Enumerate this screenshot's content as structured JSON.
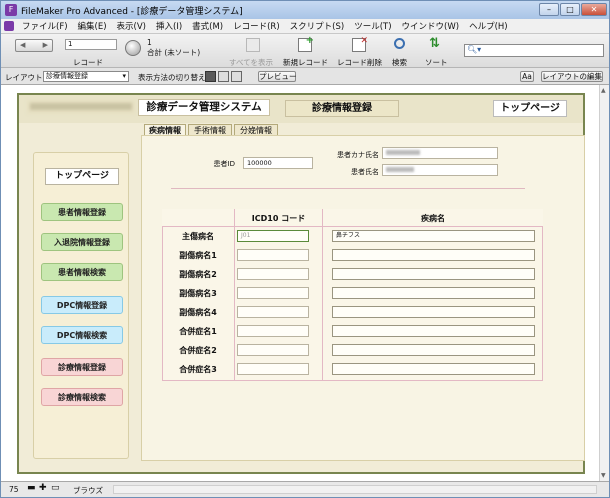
{
  "window": {
    "title": "FileMaker Pro Advanced - [診療データ管理システム]",
    "controls": [
      "–",
      "□",
      "✕"
    ]
  },
  "menu": [
    "ファイル(F)",
    "編集(E)",
    "表示(V)",
    "挿入(I)",
    "書式(M)",
    "レコード(R)",
    "スクリプト(S)",
    "ツール(T)",
    "ウインドウ(W)",
    "ヘルプ(H)"
  ],
  "toolbar": {
    "record_label": "レコード",
    "record_number": "1",
    "total_count": "1",
    "total_label": "合計 (未ソート)",
    "show_all": "すべてを表示",
    "new_record": "新規レコード",
    "delete_record": "レコード削除",
    "find": "検索",
    "sort": "ソート"
  },
  "layoutbar": {
    "layout_label": "レイアウト:",
    "layout_value": "診療情報登録",
    "view_label": "表示方法の切り替え:",
    "preview": "プレビュー",
    "aa": "Aa",
    "edit_layout": "レイアウトの編集"
  },
  "status": {
    "zoom": "75",
    "mode": "ブラウズ"
  },
  "header": {
    "system_title": "診療データ管理システム",
    "section_title": "診療情報登録",
    "top_button": "トップページ"
  },
  "tabs": [
    "疾病情報",
    "手術情報",
    "分娩情報"
  ],
  "sidebar": {
    "top_button": "トップページ",
    "items": [
      {
        "label": "患者情報登録",
        "color": "#c9e8b0"
      },
      {
        "label": "入退院情報登録",
        "color": "#c9e8b0"
      },
      {
        "label": "患者情報検索",
        "color": "#c9e8b0"
      },
      {
        "label": "DPC情報登録",
        "color": "#c9ecfb"
      },
      {
        "label": "DPC情報検索",
        "color": "#c9ecfb"
      },
      {
        "label": "診療情報登録",
        "color": "#f8d5d5"
      },
      {
        "label": "診療情報検索",
        "color": "#f8d5d5"
      }
    ]
  },
  "patient": {
    "id_label": "患者ID",
    "id_value": "100000",
    "kana_label": "患者カナ氏名",
    "name_label": "患者氏名"
  },
  "grid": {
    "col_icd": "ICD10 コード",
    "col_disease": "疾病名",
    "rows": [
      {
        "label": "主傷病名",
        "icd": "J01",
        "disease": "鼻チフス"
      },
      {
        "label": "副傷病名1",
        "icd": "",
        "disease": ""
      },
      {
        "label": "副傷病名2",
        "icd": "",
        "disease": ""
      },
      {
        "label": "副傷病名3",
        "icd": "",
        "disease": ""
      },
      {
        "label": "副傷病名4",
        "icd": "",
        "disease": ""
      },
      {
        "label": "合併症名1",
        "icd": "",
        "disease": ""
      },
      {
        "label": "合併症名2",
        "icd": "",
        "disease": ""
      },
      {
        "label": "合併症名3",
        "icd": "",
        "disease": ""
      }
    ]
  }
}
